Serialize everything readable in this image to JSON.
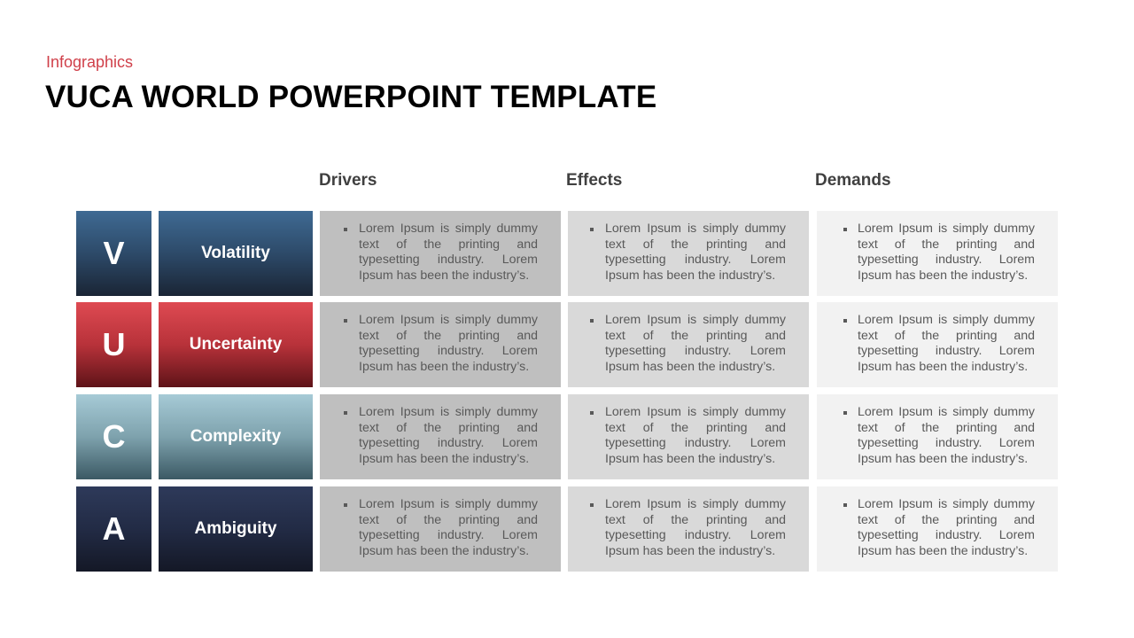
{
  "slide": {
    "subtitle": "Infographics",
    "title": "VUCA WORLD POWERPOINT TEMPLATE",
    "accent_color": "#d0404a"
  },
  "columns": {
    "drivers": "Drivers",
    "effects": "Effects",
    "demands": "Demands"
  },
  "rows": [
    {
      "letter": "V",
      "name": "Volatility",
      "color": "#3f6a93",
      "drivers": "Lorem Ipsum is simply dummy text of the printing and typesetting industry. Lorem Ipsum has been the industry’s.",
      "effects": "Lorem Ipsum is simply dummy text of the printing and typesetting industry. Lorem Ipsum has been the industry’s.",
      "demands": "Lorem Ipsum is simply dummy text of the printing and typesetting industry. Lorem Ipsum has been the industry’s."
    },
    {
      "letter": "U",
      "name": "Uncertainty",
      "color": "#de4a52",
      "drivers": "Lorem Ipsum is simply dummy text of the printing and typesetting industry. Lorem Ipsum has been the industry’s.",
      "effects": "Lorem Ipsum is simply dummy text of the printing and typesetting industry. Lorem Ipsum has been the industry’s.",
      "demands": "Lorem Ipsum is simply dummy text of the printing and typesetting industry. Lorem Ipsum has been the industry’s."
    },
    {
      "letter": "C",
      "name": "Complexity",
      "color": "#a6cad6",
      "drivers": "Lorem Ipsum is simply dummy text of the printing and typesetting industry. Lorem Ipsum has been the industry’s.",
      "effects": "Lorem Ipsum is simply dummy text of the printing and typesetting industry. Lorem Ipsum has been the industry’s.",
      "demands": "Lorem Ipsum is simply dummy text of the printing and typesetting industry. Lorem Ipsum has been the industry’s."
    },
    {
      "letter": "A",
      "name": "Ambiguity",
      "color": "#2e3a5a",
      "drivers": "Lorem Ipsum is simply dummy text of the printing and typesetting industry. Lorem Ipsum has been the industry’s.",
      "effects": "Lorem Ipsum is simply dummy text of the printing and typesetting industry. Lorem Ipsum has been the industry’s.",
      "demands": "Lorem Ipsum is simply dummy text of the printing and typesetting industry. Lorem Ipsum has been the industry’s."
    }
  ]
}
